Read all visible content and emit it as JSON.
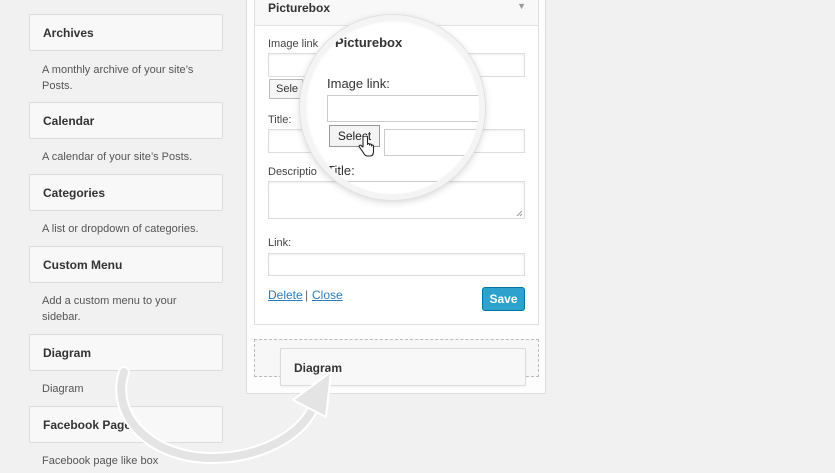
{
  "available_widgets": [
    {
      "title": "Archives",
      "description": "A monthly archive of your site’s Posts."
    },
    {
      "title": "Calendar",
      "description": "A calendar of your site’s Posts."
    },
    {
      "title": "Categories",
      "description": "A list or dropdown of categories."
    },
    {
      "title": "Custom Menu",
      "description": "Add a custom menu to your sidebar."
    },
    {
      "title": "Diagram",
      "description": "Diagram"
    },
    {
      "title": "Facebook Page",
      "description": "Facebook page like box"
    }
  ],
  "picturebox": {
    "title": "Picturebox",
    "image_link_label": "Image link:",
    "image_link_label_cut": "Image link",
    "select_label": "Select",
    "select_label_cut": "Sele",
    "title_label": "Title:",
    "description_label": "Description:",
    "description_label_cut": "Descriptio",
    "link_label": "Link:",
    "delete_label": "Delete",
    "separator": "|",
    "close_label": "Close",
    "save_label": "Save"
  },
  "dragging_widget": {
    "title": "Diagram"
  },
  "magnifier": {
    "title": "Picturebox",
    "image_link_label": "Image link:",
    "select_label": "Select",
    "title_label": "Title:"
  },
  "icons": {
    "toggle": "triangle-down-icon",
    "cursor": "hand-pointer-icon",
    "arrow": "curved-arrow-icon"
  }
}
